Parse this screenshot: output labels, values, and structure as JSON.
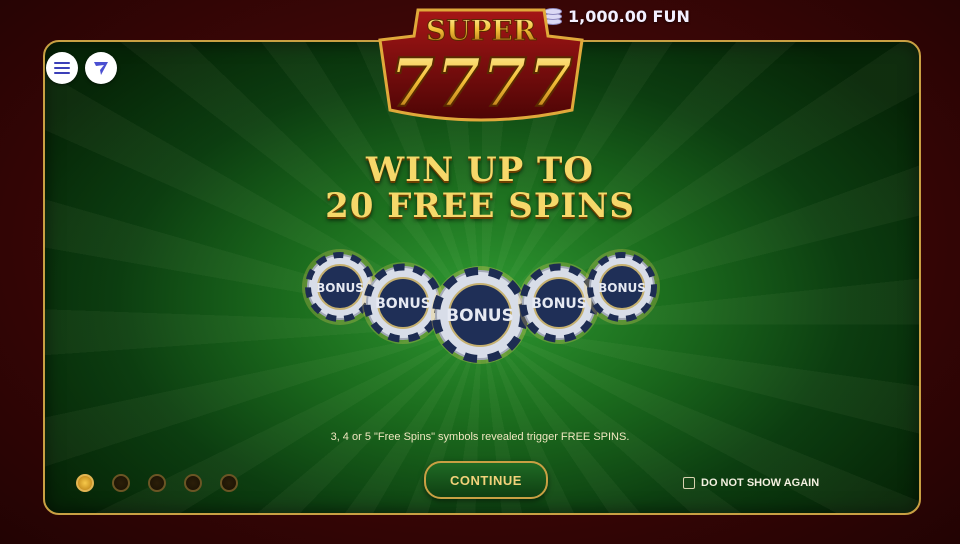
{
  "balance": {
    "amount": "1,000.00 FUN",
    "icon": "coin-stack-icon"
  },
  "header": {
    "menu_icon": "hamburger-menu-icon",
    "brand_icon": "provider-logo-icon"
  },
  "logo": {
    "line1": "SUPER",
    "line2": "7777"
  },
  "intro": {
    "headline_line1": "WIN UP TO",
    "headline_line2": "20 FREE SPINS",
    "chip_label": "BONUS",
    "rule_text": "3, 4 or 5 \"Free Spins\" symbols revealed trigger FREE SPINS."
  },
  "actions": {
    "continue_label": "CONTINUE",
    "do_not_show_label": "DO NOT SHOW AGAIN",
    "do_not_show_checked": false
  },
  "pagination": {
    "total": 5,
    "active": 1
  },
  "colors": {
    "gold": "#f6d86a",
    "felt_green": "#2f9a32",
    "frame_red": "#5a0b0b",
    "accent_blue": "#3b3fb8"
  }
}
